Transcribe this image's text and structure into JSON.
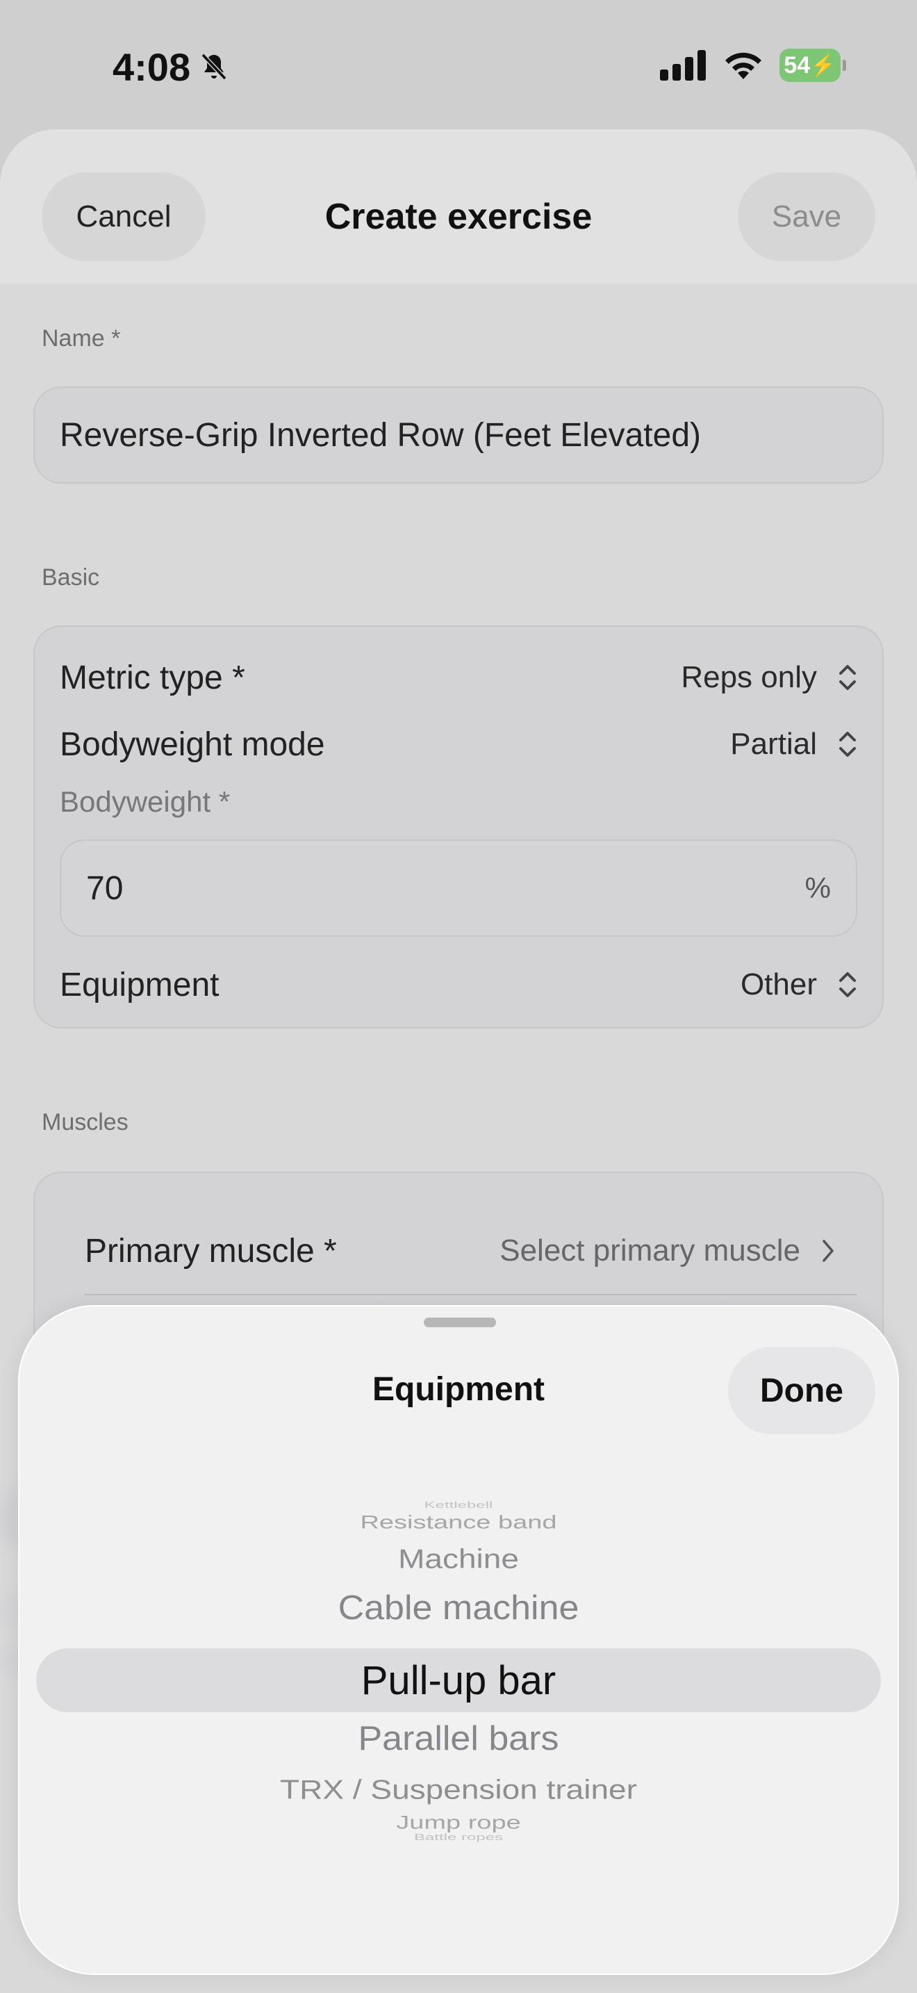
{
  "status_bar": {
    "time": "4:08",
    "battery": "54"
  },
  "header": {
    "cancel_label": "Cancel",
    "title": "Create exercise",
    "save_label": "Save"
  },
  "name_section": {
    "label": "Name *",
    "value": "Reverse-Grip Inverted Row (Feet Elevated)"
  },
  "basic_section": {
    "label": "Basic",
    "metric_type": {
      "label": "Metric type *",
      "value": "Reps only"
    },
    "bodyweight_mode": {
      "label": "Bodyweight mode",
      "value": "Partial"
    },
    "bodyweight": {
      "label": "Bodyweight *",
      "value": "70",
      "unit": "%"
    },
    "equipment": {
      "label": "Equipment",
      "value": "Other"
    }
  },
  "muscles_section": {
    "label": "Muscles",
    "primary_muscle": {
      "label": "Primary muscle *",
      "value": "Select primary muscle"
    }
  },
  "picker": {
    "title": "Equipment",
    "done_label": "Done",
    "options": [
      "Kettlebell",
      "Resistance band",
      "Machine",
      "Cable machine",
      "Pull-up bar",
      "Parallel bars",
      "TRX / Suspension trainer",
      "Jump rope",
      "Battle ropes"
    ],
    "selected": "Pull-up bar"
  }
}
